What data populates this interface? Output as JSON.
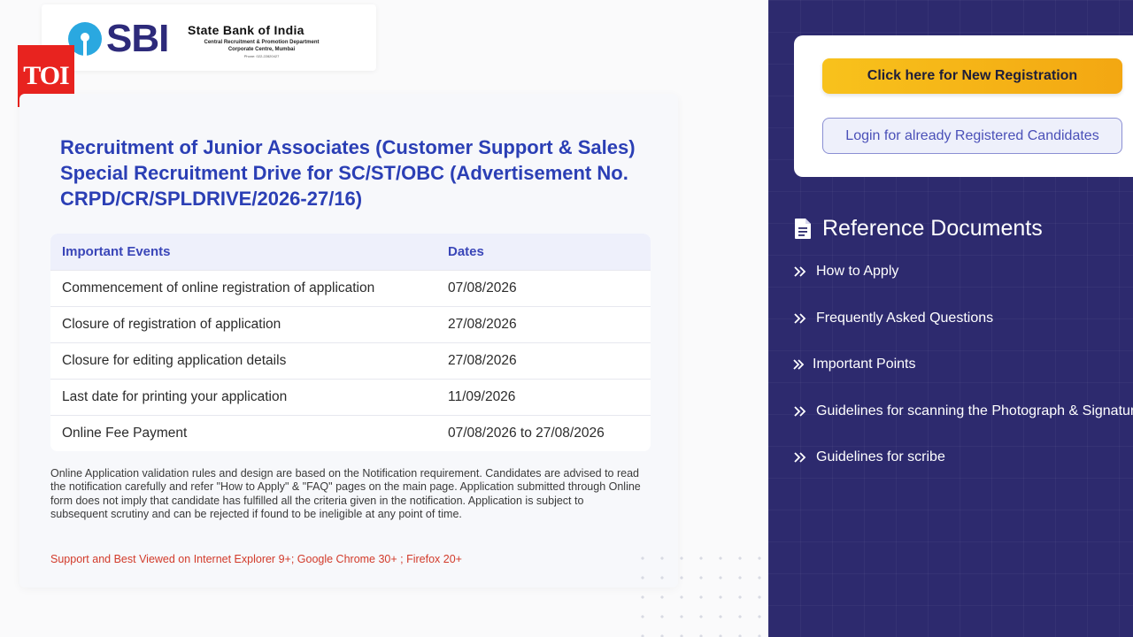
{
  "header": {
    "sbi_logo_text": "SBI",
    "bank_name": "State Bank of India",
    "department": "Central Recruitment & Promotion Department",
    "office": "Corporate Centre, Mumbai",
    "phone": "Phone: 022-22820427",
    "toi_badge": "TOI"
  },
  "main": {
    "title": "Recruitment of Junior Associates (Customer Support & Sales) Special Recruitment Drive for SC/ST/OBC (Advertisement No. CRPD/CR/SPLDRIVE/2026-27/16)",
    "table": {
      "headers": [
        "Important Events",
        "Dates"
      ],
      "rows": [
        [
          "Commencement of online registration of application",
          "07/08/2026"
        ],
        [
          "Closure of registration of application",
          "27/08/2026"
        ],
        [
          "Closure for editing application details",
          "27/08/2026"
        ],
        [
          "Last date for printing your application",
          "11/09/2026"
        ],
        [
          "Online Fee Payment",
          "07/08/2026 to 27/08/2026"
        ]
      ]
    },
    "note": "Online Application validation rules and design are based on the Notification requirement. Candidates are advised to read the notification carefully and refer \"How to Apply\" & \"FAQ\" pages on the main page. Application submitted through Online form does not imply that candidate has fulfilled all the criteria given in the notification. Application is subject to subsequent scrutiny and can be rejected if found to be ineligible at any point of time.",
    "browser_support": "Support and Best Viewed on Internet Explorer 9+; Google Chrome 30+ ; Firefox 20+"
  },
  "sidebar": {
    "register_button": "Click here for New Registration",
    "login_button": "Login for already Registered Candidates",
    "reference_title": "Reference Documents",
    "reference_icon": "document-icon",
    "items": [
      {
        "label": "How to Apply",
        "icon": "double-chevron-right-icon"
      },
      {
        "label": "Frequently Asked Questions",
        "icon": "double-chevron-right-icon"
      },
      {
        "label": "Important Points",
        "icon": "double-chevron-right-icon"
      },
      {
        "label": "Guidelines for scanning the Photograph & Signature",
        "icon": "double-chevron-right-icon"
      },
      {
        "label": "Guidelines for scribe",
        "icon": "double-chevron-right-icon"
      }
    ]
  },
  "colors": {
    "title_blue": "#2b3fb5",
    "sidebar_bg": "#2d2a6e",
    "register_yellow": "#f8c21c",
    "toi_red": "#e8231f",
    "note_red": "#d23a2a"
  }
}
